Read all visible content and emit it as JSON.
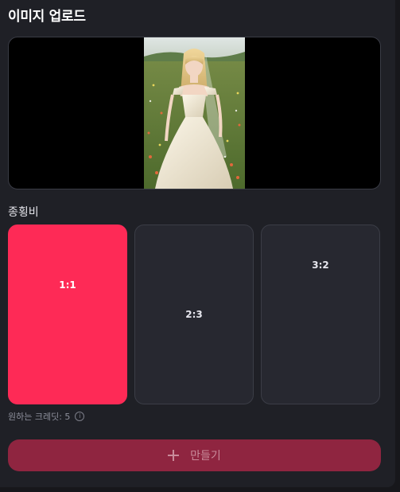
{
  "panel": {
    "title": "이미지 업로드"
  },
  "preview": {
    "image_description_icon": "uploaded-photo"
  },
  "aspect_ratio": {
    "label": "종횡비",
    "options": [
      {
        "label": "1:1",
        "selected": true
      },
      {
        "label": "2:3",
        "selected": false
      },
      {
        "label": "3:2",
        "selected": false
      }
    ]
  },
  "credits": {
    "text": "원하는 크레딧: 5",
    "icon": "info-icon"
  },
  "create_button": {
    "label": "만들기",
    "icon": "plus-icon"
  },
  "colors": {
    "accent": "#fe2a56",
    "button_bg": "#8f2540",
    "panel_bg": "#1f2026"
  }
}
